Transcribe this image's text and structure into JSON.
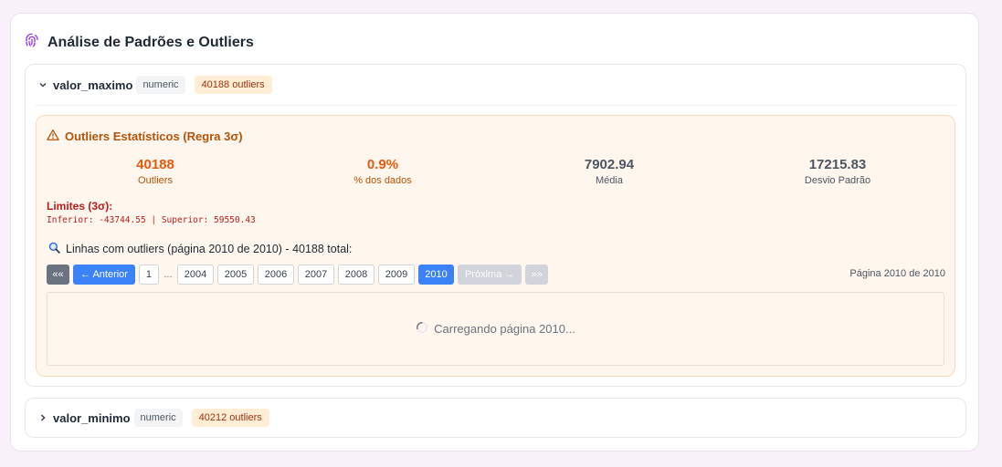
{
  "card": {
    "title": "Análise de Padrões e Outliers"
  },
  "sections": [
    {
      "field": "valor_maximo",
      "type": "numeric",
      "outliers_badge": "40188 outliers",
      "expanded": true,
      "panel": {
        "title": "Outliers Estatísticos (Regra 3σ)",
        "stats": [
          {
            "value": "40188",
            "label": "Outliers"
          },
          {
            "value": "0.9%",
            "label": "% dos dados"
          },
          {
            "value": "7902.94",
            "label": "Média"
          },
          {
            "value": "17215.83",
            "label": "Desvio Padrão"
          }
        ],
        "limits_title": "Limites (3σ):",
        "limits_values": "Inferior: -43744.55 | Superior: 59550.43",
        "rows_title": "Linhas com outliers (página 2010 de 2010) - 40188 total:",
        "pager": {
          "first": "««",
          "prev": "← Anterior",
          "pages": [
            "1",
            "...",
            "2004",
            "2005",
            "2006",
            "2007",
            "2008",
            "2009",
            "2010"
          ],
          "active": "2010",
          "next": "Próxima →",
          "last": "»»",
          "info": "Página 2010 de 2010"
        },
        "loading_text": "Carregando página 2010..."
      }
    },
    {
      "field": "valor_minimo",
      "type": "numeric",
      "outliers_badge": "40212 outliers",
      "expanded": false
    }
  ],
  "colors": {
    "accent": "#3b82f6",
    "warning": "#ea580c",
    "danger": "#b91c1c",
    "panel_bg": "#fff7ed"
  },
  "icons": [
    "fingerprint-icon",
    "chevron-down-icon",
    "chevron-right-icon",
    "warning-icon",
    "search-icon",
    "spinner-icon"
  ]
}
